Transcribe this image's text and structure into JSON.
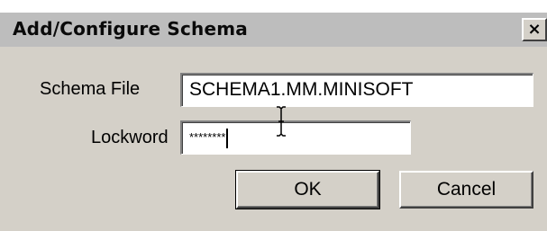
{
  "dialog": {
    "title": "Add/Configure Schema",
    "close_glyph": "×"
  },
  "form": {
    "schema_file_label": "Schema File",
    "schema_file_value": "SCHEMA1.MM.MINISOFT",
    "lockword_label": "Lockword",
    "lockword_masked": "********"
  },
  "buttons": {
    "ok_label": "OK",
    "cancel_label": "Cancel"
  },
  "icons": {
    "close": "close-icon",
    "cursor": "text-cursor-icon"
  }
}
